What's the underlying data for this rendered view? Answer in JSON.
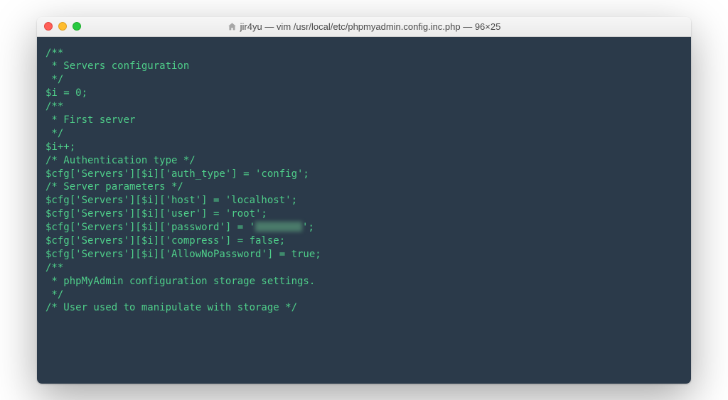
{
  "titlebar": {
    "home_icon_name": "home-icon",
    "title": "jir4yu — vim /usr/local/etc/phpmyadmin.config.inc.php — 96×25"
  },
  "terminal": {
    "lines": [
      "/**",
      " * Servers configuration",
      " */",
      "$i = 0;",
      "",
      "/**",
      " * First server",
      " */",
      "$i++;",
      "/* Authentication type */",
      "$cfg['Servers'][$i]['auth_type'] = 'config';",
      "/* Server parameters */",
      "$cfg['Servers'][$i]['host'] = 'localhost';",
      "$cfg['Servers'][$i]['user'] = 'root';",
      {
        "prefix": "$cfg['Servers'][$i]['password'] = '",
        "redacted": true,
        "suffix": "';"
      },
      "$cfg['Servers'][$i]['compress'] = false;",
      "$cfg['Servers'][$i]['AllowNoPassword'] = true;",
      "",
      "/**",
      " * phpMyAdmin configuration storage settings.",
      " */",
      "",
      "/* User used to manipulate with storage */"
    ]
  }
}
